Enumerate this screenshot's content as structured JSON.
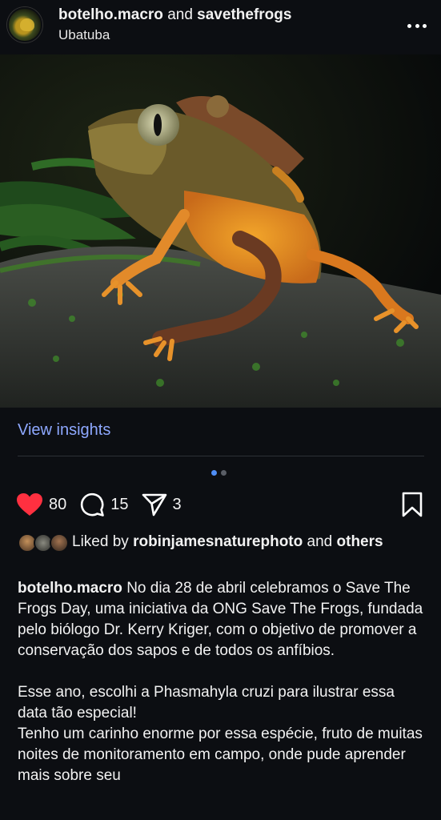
{
  "header": {
    "user1": "botelho.macro",
    "and": "and",
    "user2": "savethefrogs",
    "location": "Ubatuba"
  },
  "insights": {
    "label": "View insights"
  },
  "carousel": {
    "count": 2,
    "active": 1
  },
  "actions": {
    "likes": "80",
    "comments": "15",
    "shares": "3"
  },
  "liked": {
    "prefix": "Liked by",
    "user": "robinjamesnaturephoto",
    "and": "and",
    "others": "others"
  },
  "caption": {
    "author": "botelho.macro",
    "para1": "No dia 28 de abril celebramos o Save The Frogs Day, uma iniciativa da ONG Save The Frogs, fundada pelo biólogo Dr. Kerry Kriger, com o objetivo de promover a conservação dos sapos e de todos os anfíbios.",
    "para2": "Esse ano, escolhi a Phasmahyla cruzi para ilustrar essa data tão especial!",
    "para3": "Tenho um carinho enorme por essa espécie, fruto de muitas noites de monitoramento em campo, onde pude aprender mais sobre seu"
  },
  "colors": {
    "background": "#0c0e12",
    "heart": "#ff3040",
    "link": "#8ea8ff",
    "dot_active": "#4f8ef5"
  }
}
